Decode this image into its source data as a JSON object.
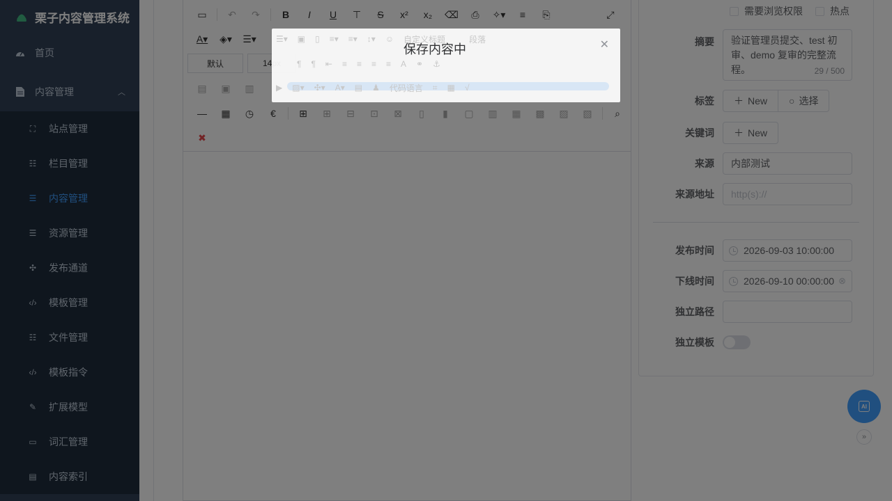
{
  "app": {
    "title": "栗子内容管理系统"
  },
  "sidebar": {
    "home": {
      "label": "首页",
      "icon": "dashboard-icon"
    },
    "group": {
      "label": "内容管理",
      "icon": "document-icon"
    },
    "items": [
      {
        "label": "站点管理",
        "icon": "site-icon"
      },
      {
        "label": "栏目管理",
        "icon": "tree-icon"
      },
      {
        "label": "内容管理",
        "icon": "list-icon",
        "active": true
      },
      {
        "label": "资源管理",
        "icon": "list-icon"
      },
      {
        "label": "发布通道",
        "icon": "puzzle-icon"
      },
      {
        "label": "模板管理",
        "icon": "code-icon"
      },
      {
        "label": "文件管理",
        "icon": "tree-icon"
      },
      {
        "label": "模板指令",
        "icon": "code-icon"
      },
      {
        "label": "扩展模型",
        "icon": "edit-doc-icon"
      },
      {
        "label": "词汇管理",
        "icon": "tag-icon"
      },
      {
        "label": "内容索引",
        "icon": "document-icon"
      }
    ]
  },
  "toolbar": {
    "font_family": "默认",
    "font_size": "14px"
  },
  "form": {
    "checkboxes": {
      "browse_permission": "需要浏览权限",
      "hot": "热点"
    },
    "summary": {
      "label": "摘要",
      "value": "验证管理员提交、test 初审、demo 复审的完整流程。",
      "count": "29 / 500"
    },
    "tags": {
      "label": "标签",
      "new": "New",
      "select": "选择"
    },
    "keywords": {
      "label": "关键词",
      "new": "New"
    },
    "source": {
      "label": "来源",
      "value": "内部测试"
    },
    "source_url": {
      "label": "来源地址",
      "placeholder": "http(s)://"
    },
    "publish_time": {
      "label": "发布时间",
      "value": "2026-09-03 10:00:00"
    },
    "offline_time": {
      "label": "下线时间",
      "value": "2026-09-10 00:00:00"
    },
    "static_path": {
      "label": "独立路径",
      "value": ""
    },
    "static_template": {
      "label": "独立模板",
      "enabled": false
    }
  },
  "ai_button": {
    "label": "AI"
  },
  "dialog": {
    "title": "保存内容中",
    "ghost_custom_title": "自定义标题",
    "ghost_paragraph": "段落",
    "ghost_code_lang": "代码语言"
  },
  "colors": {
    "sidebar_bg": "#304156",
    "submenu_bg": "#1f2d3d",
    "accent": "#409eff"
  }
}
